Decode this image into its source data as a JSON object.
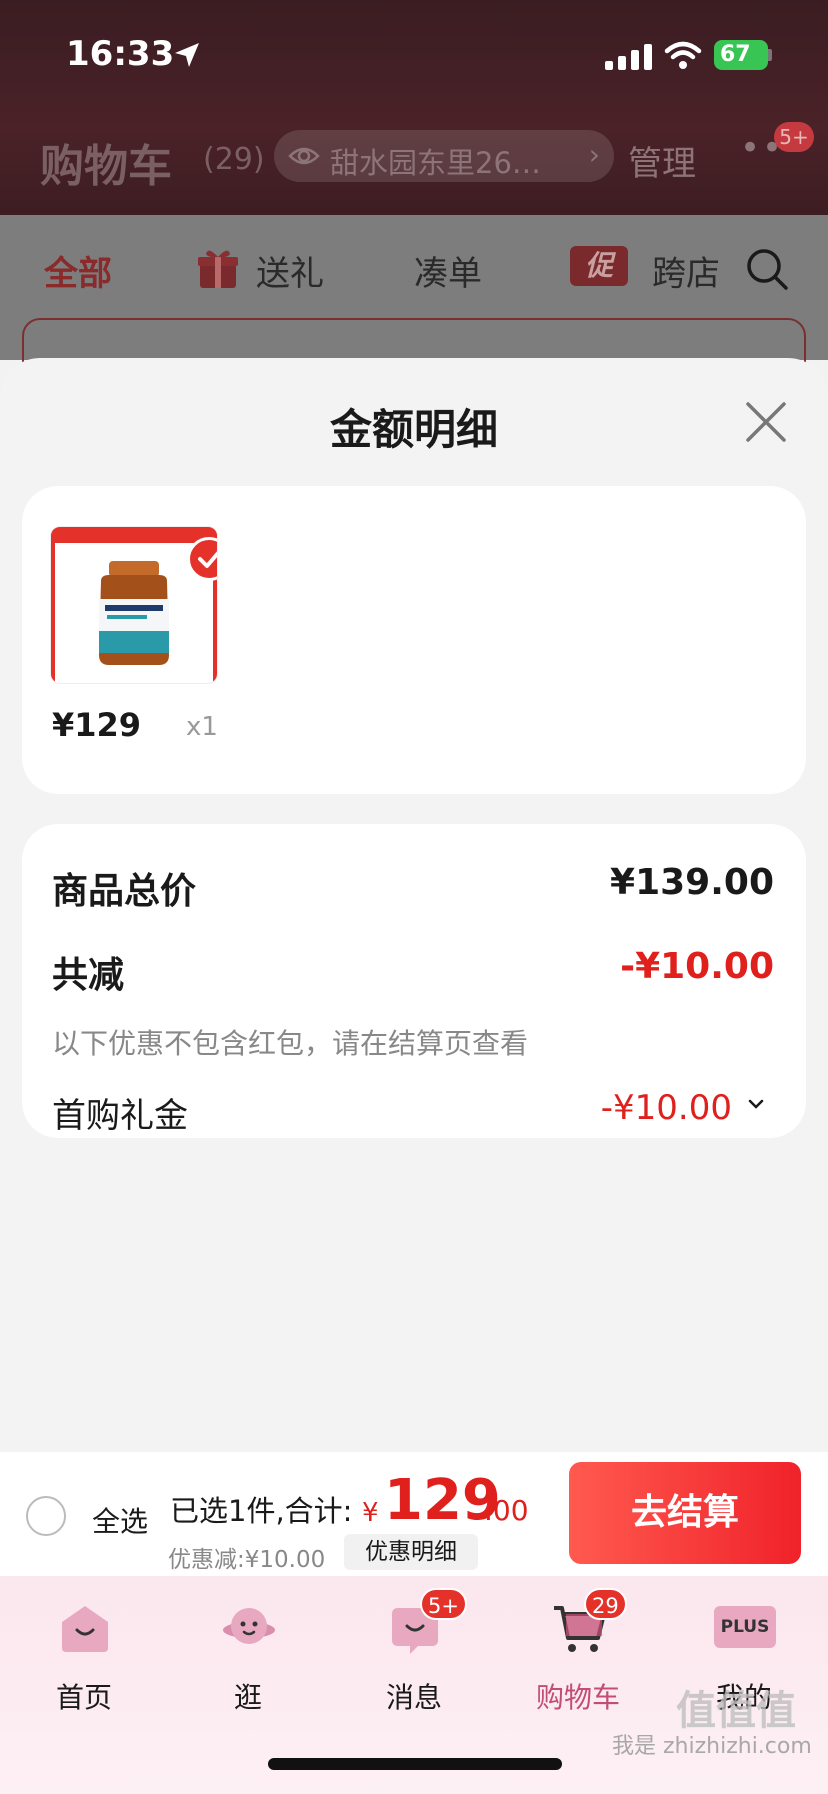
{
  "status_bar": {
    "time": "16:33",
    "battery": "67"
  },
  "header": {
    "title": "购物车",
    "count": "(29)",
    "address": "甜水园东里26…",
    "manage": "管理",
    "more_badge": "5+"
  },
  "filter_tabs": [
    {
      "label": "全部"
    },
    {
      "label": "送礼"
    },
    {
      "label": "凑单"
    },
    {
      "label": "跨店"
    }
  ],
  "promo_icon_label": "促",
  "sheet": {
    "title": "金额明细",
    "product": {
      "price": "¥129",
      "qty": "x1"
    },
    "summary": {
      "total_label": "商品总价",
      "total_value": "¥139.00",
      "reduce_label": "共减",
      "reduce_value": "-¥10.00",
      "note": "以下优惠不包含红包，请在结算页查看",
      "gift_label": "首购礼金",
      "gift_value": "-¥10.00"
    }
  },
  "checkout": {
    "select_all": "全选",
    "summary": "已选1件,合计:",
    "currency": "¥",
    "total_int": "129",
    "total_dec": ".00",
    "discount": "优惠减:¥10.00",
    "detail_button": "优惠明细",
    "checkout_button": "去结算"
  },
  "tabbar": {
    "items": [
      {
        "label": "首页"
      },
      {
        "label": "逛"
      },
      {
        "label": "消息",
        "badge": "5+"
      },
      {
        "label": "购物车",
        "badge": "29"
      },
      {
        "label": "我的",
        "icon_text": "PLUS"
      }
    ]
  },
  "colors": {
    "accent": "#e0201c",
    "active_tab": "#c24d76"
  },
  "watermark": "我是 zhizhizhi.com"
}
